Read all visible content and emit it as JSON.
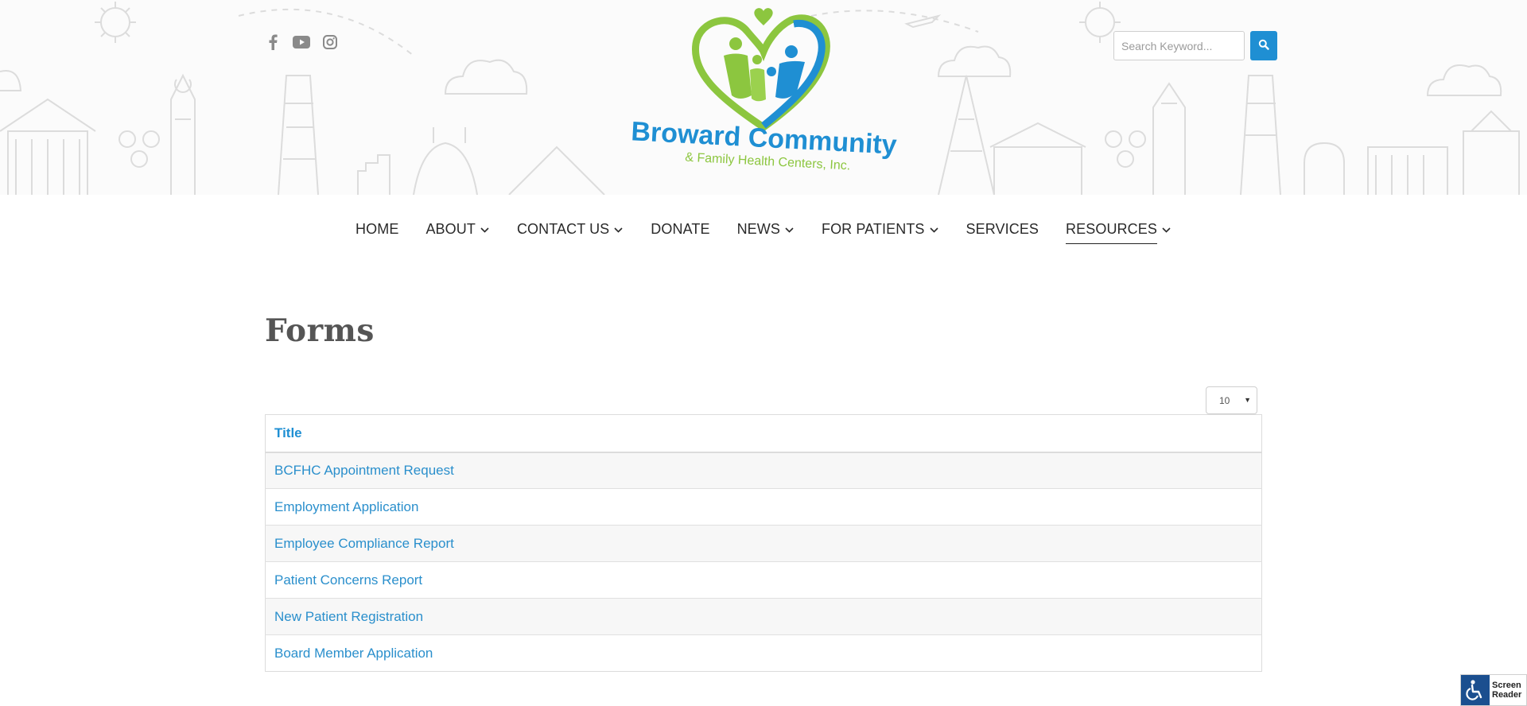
{
  "header": {
    "social": [
      {
        "name": "facebook-icon"
      },
      {
        "name": "youtube-icon"
      },
      {
        "name": "instagram-icon"
      }
    ],
    "logo": {
      "line1": "Broward Community",
      "line2": "& Family Health Centers, Inc."
    },
    "search": {
      "placeholder": "Search Keyword...",
      "button_icon": "search-icon"
    }
  },
  "nav": {
    "items": [
      {
        "label": "HOME",
        "dropdown": false
      },
      {
        "label": "ABOUT",
        "dropdown": true
      },
      {
        "label": "CONTACT US",
        "dropdown": true
      },
      {
        "label": "DONATE",
        "dropdown": false
      },
      {
        "label": "NEWS",
        "dropdown": true
      },
      {
        "label": "FOR PATIENTS",
        "dropdown": true
      },
      {
        "label": "SERVICES",
        "dropdown": false
      },
      {
        "label": "RESOURCES",
        "dropdown": true,
        "active": true
      }
    ]
  },
  "main": {
    "title": "Forms",
    "page_size": "10",
    "table": {
      "header": "Title",
      "rows": [
        "BCFHC Appointment Request",
        "Employment Application",
        "Employee Compliance Report",
        "Patient Concerns Report",
        "New Patient Registration",
        "Board Member Application"
      ]
    }
  },
  "screen_reader": {
    "line1": "Screen",
    "line2": "Reader"
  },
  "colors": {
    "accent_blue": "#1f8fd3",
    "link_blue": "#2a8fcc",
    "logo_green": "#8cc63f",
    "title_gray": "#555555"
  }
}
